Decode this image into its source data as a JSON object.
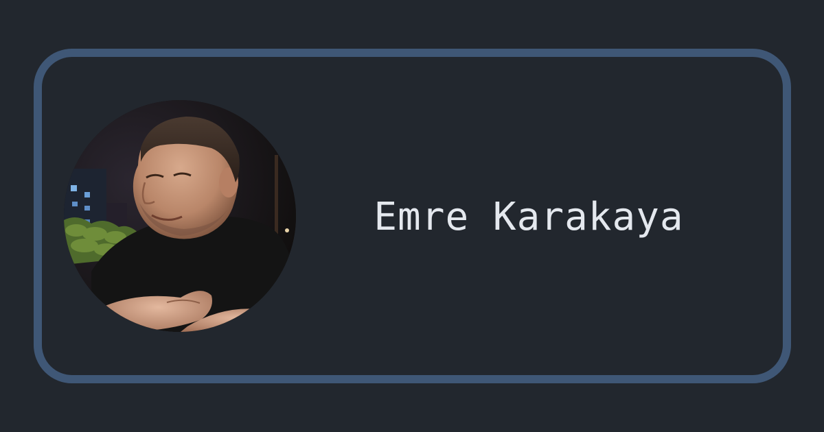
{
  "card": {
    "name": "Emre Karakaya",
    "border_color": "#3f5776",
    "background_color": "#22272e",
    "text_color": "#e4e8ee"
  },
  "avatar": {
    "icon": "profile-photo"
  }
}
